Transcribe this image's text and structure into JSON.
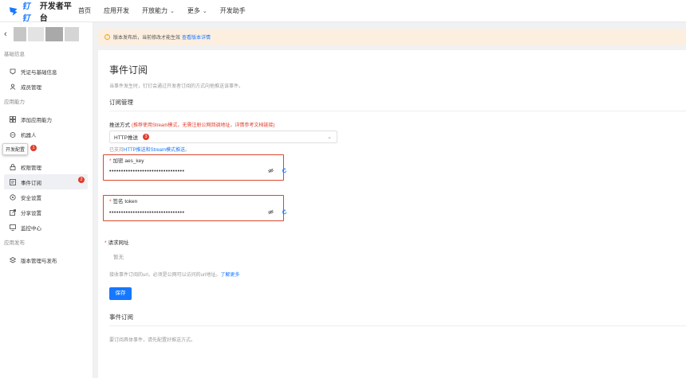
{
  "topnav": {
    "brand": "钉钉",
    "title": "开发者平台",
    "items": [
      {
        "label": "首页",
        "has_menu": false
      },
      {
        "label": "应用开发",
        "has_menu": false
      },
      {
        "label": "开放能力",
        "has_menu": true
      },
      {
        "label": "更多",
        "has_menu": true
      },
      {
        "label": "开发助手",
        "has_menu": false
      }
    ]
  },
  "sidebar": {
    "back_icon": "chevron-left-icon",
    "sections": [
      {
        "title": "基础信息",
        "items": [
          {
            "label": "凭证与基础信息",
            "icon": "credential-icon"
          },
          {
            "label": "成员管理",
            "icon": "member-icon"
          }
        ]
      },
      {
        "title": "应用能力",
        "items": [
          {
            "label": "添加应用能力",
            "icon": "grid-icon"
          },
          {
            "label": "机器人",
            "icon": "robot-icon"
          }
        ]
      },
      {
        "title": "开发配置",
        "items": [
          {
            "label": "权限管理",
            "icon": "lock-icon"
          },
          {
            "label": "事件订阅",
            "icon": "event-icon",
            "active": true
          },
          {
            "label": "安全设置",
            "icon": "shield-icon"
          },
          {
            "label": "分享设置",
            "icon": "share-icon"
          },
          {
            "label": "监控中心",
            "icon": "monitor-icon"
          }
        ]
      },
      {
        "title": "应用发布",
        "items": [
          {
            "label": "版本管理与发布",
            "icon": "version-icon"
          }
        ]
      }
    ],
    "tooltip": "开发配置",
    "badge_1": "1",
    "badge_2": "2"
  },
  "notice": {
    "text": "版本发布后，当前修改才能生效",
    "link": "查看版本详情"
  },
  "main": {
    "title": "事件订阅",
    "description": "当事件发生时，钉钉会通过开发者订阅的方式向他推送该事件。",
    "section_manage": "订阅管理",
    "push_label": "推送方式",
    "push_hint": "(推荐使用Stream模式，无需注册公网回调地址，详情参考文档链接)",
    "push_value": "HTTP推送",
    "badge_3": "3",
    "support_prefix": "已支持",
    "support_link": "HTTP推送和Stream模式推送",
    "support_suffix": "。",
    "aes_label": "加密 aes_key",
    "aes_value": "••••••••••••••••••••••••••••••••",
    "token_label": "签名 token",
    "token_value": "••••••••••••••••••••••••••••••••",
    "url_label": "请求网址",
    "url_placeholder": "暂无",
    "url_desc": "接收事件订阅的url，必须是公网可以访问的url地址。",
    "url_link": "了解更多",
    "save": "保存",
    "section_event": "事件订阅",
    "event_desc": "要订阅具体事件，请先配置好推送方式。"
  },
  "colors": {
    "accent": "#1677ff",
    "danger": "#e03c2a",
    "notice_bg": "#fcefe0"
  }
}
